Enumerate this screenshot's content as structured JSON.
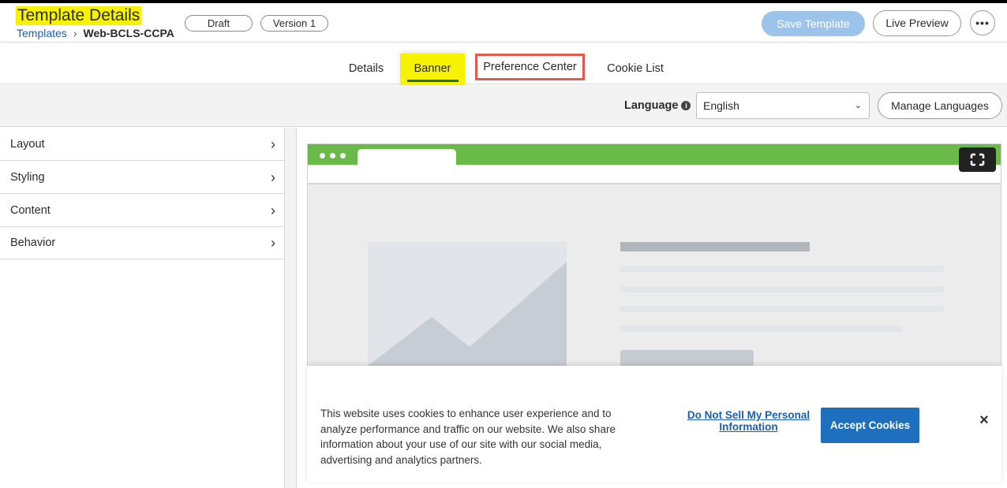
{
  "header": {
    "title": "Template Details",
    "breadcrumb": {
      "link": "Templates",
      "separator": "›",
      "current": "Web-BCLS-CCPA"
    },
    "badges": {
      "status": "Draft",
      "version": "Version 1"
    },
    "buttons": {
      "save": "Save Template",
      "live_preview": "Live Preview",
      "more": "•••"
    }
  },
  "tabs": [
    {
      "label": "Details"
    },
    {
      "label": "Banner",
      "active": true
    },
    {
      "label": "Preference Center"
    },
    {
      "label": "Cookie List"
    }
  ],
  "language_bar": {
    "label": "Language",
    "info_icon": "i",
    "selected": "English",
    "chevron": "⌄",
    "manage_button": "Manage Languages"
  },
  "sidebar": {
    "items": [
      {
        "label": "Layout",
        "arrow": "›"
      },
      {
        "label": "Styling",
        "arrow": "›"
      },
      {
        "label": "Content",
        "arrow": "›"
      },
      {
        "label": "Behavior",
        "arrow": "›"
      }
    ]
  },
  "preview": {
    "bar_color": "#6aba4a",
    "banner": {
      "text": "This website uses cookies to enhance user experience and to analyze performance and traffic on our website. We also share information about your use of our site with our social media, advertising and analytics partners.",
      "dns_link": "Do Not Sell My Personal Information",
      "accept_button": "Accept Cookies",
      "close": "×"
    }
  },
  "colors": {
    "highlight": "#f7f200",
    "primary": "#1f6fbf",
    "save_disabled": "#9cc4eb",
    "annotation_red": "#e05a4e",
    "tab_underline": "#206b3a"
  }
}
